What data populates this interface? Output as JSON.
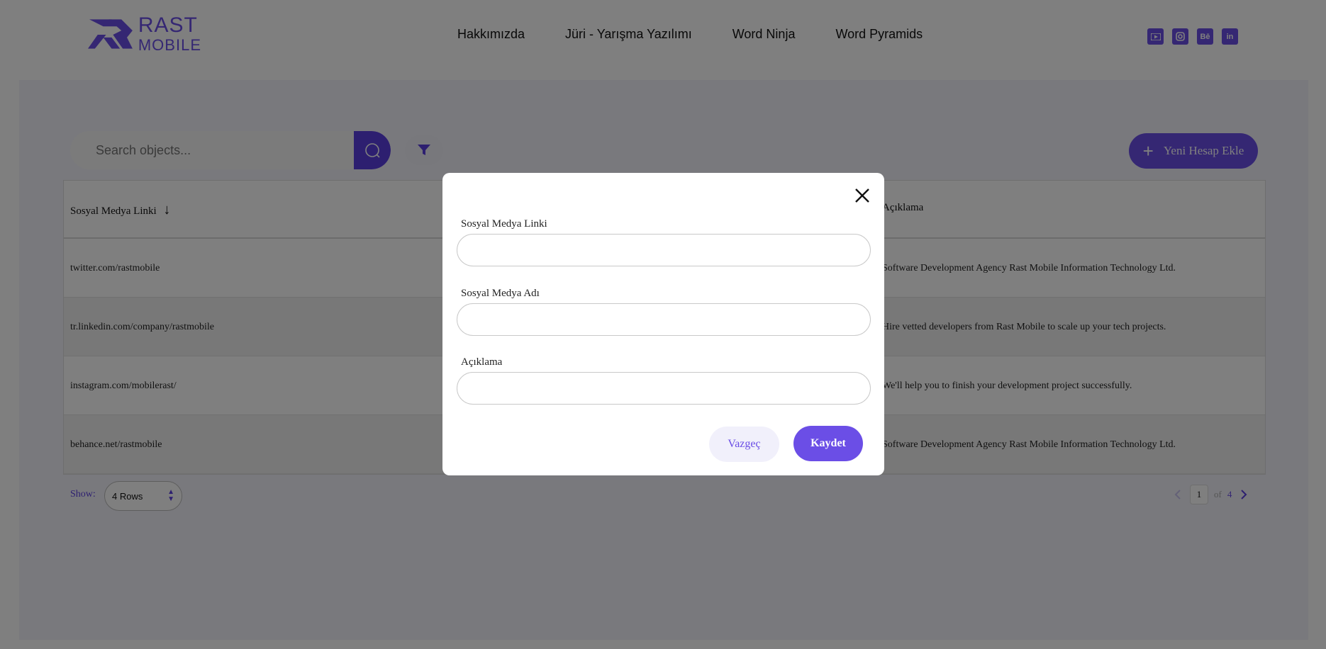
{
  "brand": {
    "name_line1": "RAST",
    "name_line2": "MOBILE",
    "color": "#6b4ee6"
  },
  "nav": {
    "items": [
      {
        "label": "Hakkımızda"
      },
      {
        "label": "Jüri - Yarışma Yazılımı"
      },
      {
        "label": "Word Ninja"
      },
      {
        "label": "Word Pyramids"
      }
    ]
  },
  "socials": [
    {
      "icon": "youtube-icon",
      "glyph": "▶"
    },
    {
      "icon": "instagram-icon",
      "glyph": "◎"
    },
    {
      "icon": "behance-icon",
      "glyph": "Bē"
    },
    {
      "icon": "linkedin-icon",
      "glyph": "in"
    }
  ],
  "toolbar": {
    "search_placeholder": "Search objects...",
    "add_button_label": "Yeni Hesap Ekle",
    "add_button_icon": "+"
  },
  "table": {
    "columns": [
      {
        "label": "Sosyal Medya Linki",
        "sort": "↓"
      },
      {
        "label": "Açıklama"
      }
    ],
    "rows": [
      {
        "link": "twitter.com/rastmobile",
        "desc": "Software Development Agency Rast Mobile Information Technology Ltd."
      },
      {
        "link": "tr.linkedin.com/company/rastmobile",
        "desc": "Hire vetted developers from Rast Mobile to scale up your tech projects."
      },
      {
        "link": "instagram.com/mobilerast/",
        "desc": "We'll help you to finish your development project successfully."
      },
      {
        "link": "behance.net/rastmobile",
        "desc": "Software Development Agency Rast Mobile Information Technology Ltd."
      }
    ]
  },
  "pagination": {
    "show_label": "Show:",
    "rows_value": "4 Rows",
    "current_page": "1",
    "of_label": "of",
    "total_pages": "4"
  },
  "modal": {
    "fields": [
      {
        "label": "Sosyal Medya Linki",
        "value": ""
      },
      {
        "label": "Sosyal Medya Adı",
        "value": ""
      },
      {
        "label": "Açıklama",
        "value": ""
      }
    ],
    "cancel_label": "Vazgeç",
    "save_label": "Kaydet"
  },
  "colors": {
    "accent": "#6b4ee6",
    "accent_dark": "#5a3fe0"
  }
}
